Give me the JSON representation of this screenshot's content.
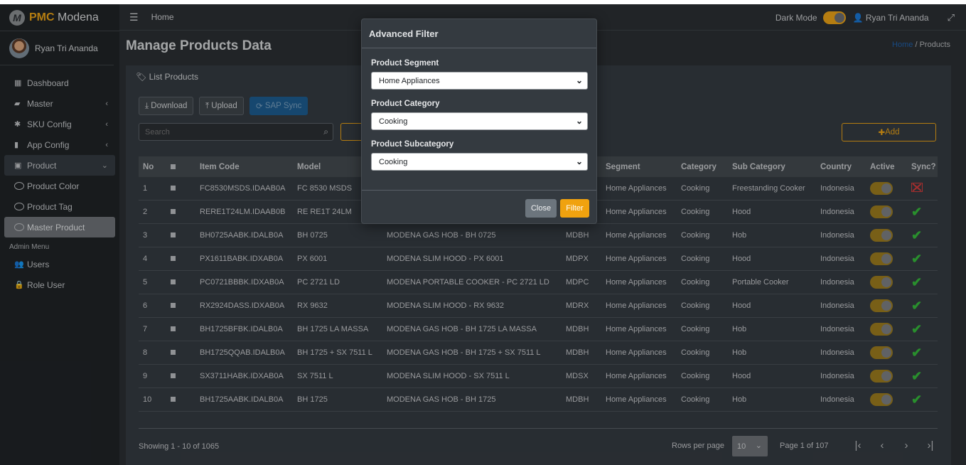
{
  "brand": {
    "bold": "PMC",
    "rest": " Modena",
    "logo": "M"
  },
  "user": {
    "name": "Ryan Tri Ananda"
  },
  "sidebar": {
    "items": [
      {
        "label": "Dashboard",
        "icon": "grid-icon"
      },
      {
        "label": "Master",
        "icon": "car-icon"
      },
      {
        "label": "SKU Config",
        "icon": "gear-icon"
      },
      {
        "label": "App Config",
        "icon": "mobile-icon"
      },
      {
        "label": "Product",
        "icon": "briefcase-icon"
      }
    ],
    "product_sub": [
      "Product Color",
      "Product Tag",
      "Master Product"
    ],
    "admin_header": "Admin Menu",
    "admin_items": [
      {
        "label": "Users",
        "icon": "users-icon"
      },
      {
        "label": "Role User",
        "icon": "lock-icon"
      }
    ]
  },
  "header": {
    "home": "Home",
    "dark_mode": "Dark Mode",
    "user": "Ryan Tri Ananda"
  },
  "page": {
    "title": "Manage Products Data",
    "crumb_home": "Home",
    "crumb_sep": "/",
    "crumb_current": "Products"
  },
  "card": {
    "title": "List Products",
    "download": "Download",
    "upload": "Upload",
    "sap_sync": "SAP Sync",
    "search_placeholder": "Search",
    "add": "Add"
  },
  "table": {
    "headers": [
      "No",
      "",
      "Item Code",
      "Model",
      "",
      "",
      "Segment",
      "Category",
      "Sub Category",
      "Country",
      "Active",
      "Sync?"
    ],
    "rows": [
      {
        "no": "1",
        "code": "FC8530MSDS.IDAAB0A",
        "model": "FC 8530 MSDS",
        "desc": "",
        "mdl": "",
        "seg": "Home Appliances",
        "cat": "Cooking",
        "sub": "Freestanding Cooker",
        "cty": "Indonesia",
        "sync": "failed"
      },
      {
        "no": "2",
        "code": "RERE1T24LM.IDAAB0B",
        "model": "RE RE1T 24LM",
        "desc": "",
        "mdl": "",
        "seg": "Home Appliances",
        "cat": "Cooking",
        "sub": "Hood",
        "cty": "Indonesia",
        "sync": "ok"
      },
      {
        "no": "3",
        "code": "BH0725AABK.IDALB0A",
        "model": "BH 0725",
        "desc": "MODENA GAS HOB - BH 0725",
        "mdl": "MDBH",
        "seg": "Home Appliances",
        "cat": "Cooking",
        "sub": "Hob",
        "cty": "Indonesia",
        "sync": "ok"
      },
      {
        "no": "4",
        "code": "PX1611BABK.IDXAB0A",
        "model": "PX 6001",
        "desc": "MODENA SLIM HOOD - PX 6001",
        "mdl": "MDPX",
        "seg": "Home Appliances",
        "cat": "Cooking",
        "sub": "Hood",
        "cty": "Indonesia",
        "sync": "ok"
      },
      {
        "no": "5",
        "code": "PC0721BBBK.IDXAB0A",
        "model": "PC 2721 LD",
        "desc": "MODENA PORTABLE COOKER - PC 2721 LD",
        "mdl": "MDPC",
        "seg": "Home Appliances",
        "cat": "Cooking",
        "sub": "Portable Cooker",
        "cty": "Indonesia",
        "sync": "ok"
      },
      {
        "no": "6",
        "code": "RX2924DASS.IDXAB0A",
        "model": "RX 9632",
        "desc": "MODENA SLIM HOOD - RX 9632",
        "mdl": "MDRX",
        "seg": "Home Appliances",
        "cat": "Cooking",
        "sub": "Hood",
        "cty": "Indonesia",
        "sync": "ok"
      },
      {
        "no": "7",
        "code": "BH1725BFBK.IDALB0A",
        "model": "BH 1725 LA MASSA",
        "desc": "MODENA GAS HOB - BH 1725 LA MASSA",
        "mdl": "MDBH",
        "seg": "Home Appliances",
        "cat": "Cooking",
        "sub": "Hob",
        "cty": "Indonesia",
        "sync": "ok"
      },
      {
        "no": "8",
        "code": "BH1725QQAB.IDALB0A",
        "model": "BH 1725 + SX 7511 L",
        "desc": "MODENA GAS HOB - BH 1725 + SX 7511 L",
        "mdl": "MDBH",
        "seg": "Home Appliances",
        "cat": "Cooking",
        "sub": "Hob",
        "cty": "Indonesia",
        "sync": "ok"
      },
      {
        "no": "9",
        "code": "SX3711HABK.IDXAB0A",
        "model": "SX 7511 L",
        "desc": "MODENA SLIM HOOD - SX 7511 L",
        "mdl": "MDSX",
        "seg": "Home Appliances",
        "cat": "Cooking",
        "sub": "Hood",
        "cty": "Indonesia",
        "sync": "ok"
      },
      {
        "no": "10",
        "code": "BH1725AABK.IDALB0A",
        "model": "BH 1725",
        "desc": "MODENA GAS HOB - BH 1725",
        "mdl": "MDBH",
        "seg": "Home Appliances",
        "cat": "Cooking",
        "sub": "Hob",
        "cty": "Indonesia",
        "sync": "ok"
      }
    ]
  },
  "footer": {
    "showing": "Showing 1 - 10 of 1065",
    "rows_label": "Rows per page",
    "rows_value": "10",
    "page_of": "Page 1 of 107"
  },
  "modal": {
    "title": "Advanced Filter",
    "segment_label": "Product Segment",
    "segment_value": "Home Appliances",
    "category_label": "Product Category",
    "category_value": "Cooking",
    "subcategory_label": "Product Subcategory",
    "subcategory_value": "Cooking",
    "close": "Close",
    "filter": "Filter"
  },
  "colors": {
    "accent": "#e8a116",
    "sync_ok": "#35b83a",
    "sync_fail": "#d33b3b",
    "sap": "#1d5c8f"
  }
}
